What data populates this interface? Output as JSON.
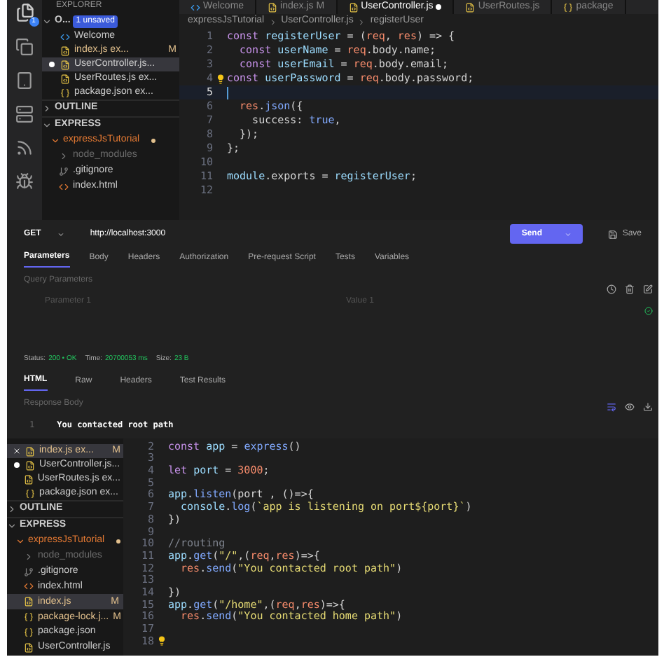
{
  "top_editor": {
    "tabs": [
      {
        "label": "Welcome",
        "kind": "vscode",
        "selected": false,
        "unsaved": false
      },
      {
        "label": "index.js M",
        "kind": "js",
        "selected": false,
        "unsaved": false
      },
      {
        "label": "UserController.js",
        "kind": "js",
        "selected": true,
        "unsaved": true
      },
      {
        "label": "UserRoutes.js",
        "kind": "js",
        "selected": false,
        "unsaved": false
      },
      {
        "label": "package",
        "kind": "json",
        "selected": false,
        "unsaved": false
      }
    ],
    "activity_badge": "1",
    "explorer_title": "EXPLORER",
    "open_editors": {
      "label": "O...",
      "badge": "1 unsaved",
      "expanded": true,
      "items": [
        {
          "label": "Welcome",
          "kind": "vscode",
          "selected": false,
          "unsaved": false,
          "show_close": false
        },
        {
          "label": "index.js ex...",
          "kind": "js",
          "git_status": "M",
          "selected": false,
          "unsaved": false,
          "show_close": false
        },
        {
          "label": "UserController.js...",
          "kind": "js",
          "selected": true,
          "unsaved": true,
          "show_close": false
        },
        {
          "label": "UserRoutes.js ex...",
          "kind": "js",
          "selected": false,
          "unsaved": false,
          "show_close": false
        },
        {
          "label": "package.json ex...",
          "kind": "json",
          "selected": false,
          "unsaved": false,
          "show_close": false
        }
      ]
    },
    "outline": {
      "label": "OUTLINE",
      "expanded": false
    },
    "project": {
      "label": "EXPRESS",
      "expanded": true,
      "folder": {
        "label": "expressJsTutorial",
        "expanded": true,
        "children": [
          {
            "label": "node_modules",
            "kind": "folder",
            "selected": false,
            "dimmed": true
          },
          {
            "label": ".gitignore",
            "kind": "git",
            "selected": false,
            "dimmed": false
          },
          {
            "label": "index.html",
            "kind": "html",
            "selected": false,
            "dimmed": false
          }
        ]
      }
    },
    "breadcrumb": [
      "expressJsTutorial",
      "UserController.js",
      "registerUser"
    ],
    "lines": [
      {
        "number": "1",
        "lightbulb": false,
        "current": false,
        "tokens": [
          {
            "kind": "keyword",
            "text": "const "
          },
          {
            "kind": "name",
            "text": "registerUser"
          },
          {
            "kind": "plain",
            "text": " = ("
          },
          {
            "kind": "param",
            "text": "req"
          },
          {
            "kind": "plain",
            "text": ", "
          },
          {
            "kind": "param",
            "text": "res"
          },
          {
            "kind": "plain",
            "text": ") => {"
          }
        ]
      },
      {
        "number": "2",
        "lightbulb": false,
        "current": false,
        "tokens": [
          {
            "kind": "keyword",
            "text": "  const "
          },
          {
            "kind": "name",
            "text": "userName"
          },
          {
            "kind": "plain",
            "text": " = "
          },
          {
            "kind": "param",
            "text": "req"
          },
          {
            "kind": "plain",
            "text": ".body.name;"
          }
        ]
      },
      {
        "number": "3",
        "lightbulb": false,
        "current": false,
        "tokens": [
          {
            "kind": "keyword",
            "text": "  const "
          },
          {
            "kind": "name",
            "text": "userEmail"
          },
          {
            "kind": "plain",
            "text": " = "
          },
          {
            "kind": "param",
            "text": "req"
          },
          {
            "kind": "plain",
            "text": ".body.email;"
          }
        ]
      },
      {
        "number": "4",
        "lightbulb": true,
        "current": false,
        "tokens": [
          {
            "kind": "keyword",
            "text": "const "
          },
          {
            "kind": "name",
            "text": "userPassword"
          },
          {
            "kind": "plain",
            "text": " = "
          },
          {
            "kind": "param",
            "text": "req"
          },
          {
            "kind": "plain",
            "text": ".body.password;"
          }
        ]
      },
      {
        "number": "5",
        "lightbulb": false,
        "current": true
      },
      {
        "number": "6",
        "lightbulb": false,
        "current": false,
        "tokens": [
          {
            "kind": "param",
            "text": "  res"
          },
          {
            "kind": "plain",
            "text": "."
          },
          {
            "kind": "func",
            "text": "json"
          },
          {
            "kind": "plain",
            "text": "({"
          }
        ]
      },
      {
        "number": "7",
        "lightbulb": false,
        "current": false,
        "tokens": [
          {
            "kind": "plain",
            "text": "    success: "
          },
          {
            "kind": "bool",
            "text": "true"
          },
          {
            "kind": "plain",
            "text": ","
          }
        ]
      },
      {
        "number": "8",
        "lightbulb": false,
        "current": false,
        "tokens": [
          {
            "kind": "plain",
            "text": "  });"
          }
        ]
      },
      {
        "number": "9",
        "lightbulb": false,
        "current": false,
        "tokens": [
          {
            "kind": "plain",
            "text": "};"
          }
        ]
      },
      {
        "number": "10",
        "lightbulb": false,
        "current": false
      },
      {
        "number": "11",
        "lightbulb": false,
        "current": false,
        "tokens": [
          {
            "kind": "name",
            "text": "module"
          },
          {
            "kind": "plain",
            "text": ".exports = "
          },
          {
            "kind": "name",
            "text": "registerUser"
          },
          {
            "kind": "plain",
            "text": ";"
          }
        ]
      },
      {
        "number": "12",
        "lightbulb": false,
        "current": false
      }
    ]
  },
  "request": {
    "method": "GET",
    "url": "http://localhost:3000",
    "send": "Send",
    "save": "Save",
    "tabs": [
      {
        "label": "Parameters",
        "selected": true
      },
      {
        "label": "Body",
        "selected": false
      },
      {
        "label": "Headers",
        "selected": false
      },
      {
        "label": "Authorization",
        "selected": false
      },
      {
        "label": "Pre-request Script",
        "selected": false
      },
      {
        "label": "Tests",
        "selected": false
      },
      {
        "label": "Variables",
        "selected": false
      }
    ],
    "query_title": "Query Parameters",
    "parameter": {
      "placeholder": "Parameter 1"
    },
    "value": {
      "placeholder": "Value 1"
    },
    "status_label": "Status:",
    "status": "200 • OK",
    "time_label": "Time:",
    "time": "20700053 ms",
    "size_label": "Size:",
    "size": "23 B",
    "response_tabs": [
      {
        "label": "HTML",
        "selected": true
      },
      {
        "label": "Raw",
        "selected": false
      },
      {
        "label": "Headers",
        "selected": false
      },
      {
        "label": "Test Results",
        "selected": false
      }
    ],
    "response_title": "Response Body",
    "response_lines": [
      {
        "number": "1",
        "text": "You contacted root path"
      }
    ]
  },
  "bottom_editor": {
    "open_editors": [
      {
        "label": "index.js ex...",
        "kind": "js",
        "git_status": "M",
        "selected": true,
        "unsaved": false,
        "show_close": true
      },
      {
        "label": "UserController.js...",
        "kind": "js",
        "selected": false,
        "unsaved": true,
        "show_close": false
      },
      {
        "label": "UserRoutes.js ex...",
        "kind": "js",
        "selected": false,
        "unsaved": false,
        "show_close": false
      },
      {
        "label": "package.json ex...",
        "kind": "json",
        "selected": false,
        "unsaved": false,
        "show_close": false
      }
    ],
    "outline": {
      "label": "OUTLINE",
      "expanded": false
    },
    "project": {
      "label": "EXPRESS",
      "expanded": true,
      "folder": {
        "label": "expressJsTutorial",
        "expanded": true,
        "children": [
          {
            "label": "node_modules",
            "kind": "folder",
            "selected": false,
            "dimmed": true
          },
          {
            "label": ".gitignore",
            "kind": "git",
            "selected": false,
            "dimmed": false
          },
          {
            "label": "index.html",
            "kind": "html",
            "selected": false,
            "dimmed": false
          },
          {
            "label": "index.js",
            "kind": "js",
            "git_status": "M",
            "selected": true,
            "dimmed": false
          },
          {
            "label": "package-lock.j...",
            "kind": "json",
            "git_status": "M",
            "selected": false,
            "dimmed": false
          },
          {
            "label": "package.json",
            "kind": "json",
            "selected": false,
            "dimmed": false
          },
          {
            "label": "UserController.js",
            "kind": "js",
            "selected": false,
            "dimmed": false
          }
        ]
      }
    },
    "lines": [
      {
        "number": "2",
        "lightbulb": false,
        "current": false,
        "tokens": [
          {
            "kind": "keyword",
            "text": "const "
          },
          {
            "kind": "name",
            "text": "app"
          },
          {
            "kind": "plain",
            "text": " = "
          },
          {
            "kind": "func",
            "text": "express"
          },
          {
            "kind": "plain",
            "text": "()"
          }
        ]
      },
      {
        "number": "3",
        "lightbulb": false,
        "current": false
      },
      {
        "number": "4",
        "lightbulb": false,
        "current": false,
        "tokens": [
          {
            "kind": "keyword",
            "text": "let "
          },
          {
            "kind": "name",
            "text": "port"
          },
          {
            "kind": "plain",
            "text": " = "
          },
          {
            "kind": "number",
            "text": "3000"
          },
          {
            "kind": "plain",
            "text": ";"
          }
        ]
      },
      {
        "number": "5",
        "lightbulb": false,
        "current": false
      },
      {
        "number": "6",
        "lightbulb": false,
        "current": false,
        "tokens": [
          {
            "kind": "name",
            "text": "app"
          },
          {
            "kind": "plain",
            "text": "."
          },
          {
            "kind": "func",
            "text": "listen"
          },
          {
            "kind": "plain",
            "text": "(port , ()=>{"
          }
        ]
      },
      {
        "number": "7",
        "lightbulb": false,
        "current": false,
        "tokens": [
          {
            "kind": "name",
            "text": "  console"
          },
          {
            "kind": "plain",
            "text": "."
          },
          {
            "kind": "func",
            "text": "log"
          },
          {
            "kind": "plain",
            "text": "("
          },
          {
            "kind": "string",
            "text": "`app is listening on port${port}`"
          },
          {
            "kind": "plain",
            "text": ")"
          }
        ]
      },
      {
        "number": "8",
        "lightbulb": false,
        "current": false,
        "tokens": [
          {
            "kind": "plain",
            "text": "})"
          }
        ]
      },
      {
        "number": "9",
        "lightbulb": false,
        "current": false
      },
      {
        "number": "10",
        "lightbulb": false,
        "current": false,
        "tokens": [
          {
            "kind": "comment",
            "text": "//routing"
          }
        ]
      },
      {
        "number": "11",
        "lightbulb": false,
        "current": false,
        "tokens": [
          {
            "kind": "name",
            "text": "app"
          },
          {
            "kind": "plain",
            "text": "."
          },
          {
            "kind": "func",
            "text": "get"
          },
          {
            "kind": "plain",
            "text": "("
          },
          {
            "kind": "string",
            "text": "\"/\""
          },
          {
            "kind": "plain",
            "text": ",("
          },
          {
            "kind": "param",
            "text": "req"
          },
          {
            "kind": "plain",
            "text": ","
          },
          {
            "kind": "param",
            "text": "res"
          },
          {
            "kind": "plain",
            "text": ")=>{"
          }
        ]
      },
      {
        "number": "12",
        "lightbulb": false,
        "current": false,
        "tokens": [
          {
            "kind": "param",
            "text": "  res"
          },
          {
            "kind": "plain",
            "text": "."
          },
          {
            "kind": "func",
            "text": "send"
          },
          {
            "kind": "plain",
            "text": "("
          },
          {
            "kind": "string",
            "text": "\"You contacted root path\""
          },
          {
            "kind": "plain",
            "text": ")"
          }
        ]
      },
      {
        "number": "13",
        "lightbulb": false,
        "current": false
      },
      {
        "number": "14",
        "lightbulb": false,
        "current": false,
        "tokens": [
          {
            "kind": "plain",
            "text": "})"
          }
        ]
      },
      {
        "number": "15",
        "lightbulb": false,
        "current": false,
        "tokens": [
          {
            "kind": "name",
            "text": "app"
          },
          {
            "kind": "plain",
            "text": "."
          },
          {
            "kind": "func",
            "text": "get"
          },
          {
            "kind": "plain",
            "text": "("
          },
          {
            "kind": "string",
            "text": "\"/home\""
          },
          {
            "kind": "plain",
            "text": ",("
          },
          {
            "kind": "param",
            "text": "req"
          },
          {
            "kind": "plain",
            "text": ","
          },
          {
            "kind": "param",
            "text": "res"
          },
          {
            "kind": "plain",
            "text": ")=>{"
          }
        ]
      },
      {
        "number": "16",
        "lightbulb": false,
        "current": false,
        "tokens": [
          {
            "kind": "param",
            "text": "  res"
          },
          {
            "kind": "plain",
            "text": "."
          },
          {
            "kind": "func",
            "text": "send"
          },
          {
            "kind": "plain",
            "text": "("
          },
          {
            "kind": "string",
            "text": "\"You contacted home path\""
          },
          {
            "kind": "plain",
            "text": ")"
          }
        ]
      },
      {
        "number": "17",
        "lightbulb": false,
        "current": false
      },
      {
        "number": "18",
        "lightbulb": true,
        "current": false
      }
    ]
  }
}
